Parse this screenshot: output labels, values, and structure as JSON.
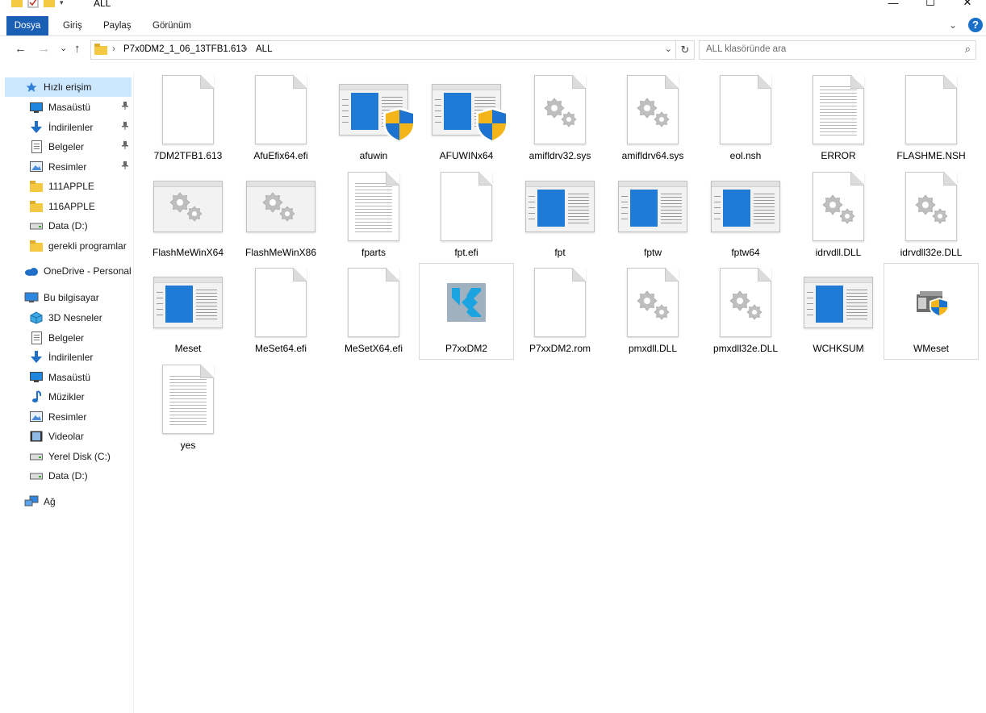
{
  "window": {
    "title": "ALL",
    "minimize_glyph": "—",
    "maximize_glyph": "☐",
    "close_glyph": "✕"
  },
  "ribbon": {
    "tabs": [
      "Dosya",
      "Giriş",
      "Paylaş",
      "Görünüm"
    ],
    "help_label": "?",
    "accent_color": "#1a5fb4"
  },
  "navigation": {
    "back_glyph": "←",
    "forward_glyph": "→",
    "recent_glyph": "⌄",
    "up_glyph": "↑",
    "breadcrumbs": [
      "P7x0DM2_1_06_13TFB1.613",
      "ALL"
    ],
    "separator": "›",
    "refresh_glyph": "↻",
    "search_placeholder": "ALL klasöründe ara"
  },
  "sidebar": {
    "quick_access": "Hızlı erişim",
    "quick_items": [
      {
        "label": "Masaüstü",
        "icon": "desktop-icon",
        "pinned": true
      },
      {
        "label": "İndirilenler",
        "icon": "download-icon",
        "pinned": true
      },
      {
        "label": "Belgeler",
        "icon": "documents-icon",
        "pinned": true
      },
      {
        "label": "Resimler",
        "icon": "pictures-icon",
        "pinned": true
      },
      {
        "label": "111APPLE",
        "icon": "folder-icon",
        "pinned": false
      },
      {
        "label": "116APPLE",
        "icon": "folder-icon",
        "pinned": false
      },
      {
        "label": "Data (D:)",
        "icon": "drive-icon",
        "pinned": false
      },
      {
        "label": "gerekli programlar",
        "icon": "folder-icon",
        "pinned": false
      }
    ],
    "onedrive": "OneDrive - Personal",
    "this_pc": "Bu bilgisayar",
    "pc_items": [
      {
        "label": "3D Nesneler",
        "icon": "3d-objects-icon"
      },
      {
        "label": "Belgeler",
        "icon": "documents-icon"
      },
      {
        "label": "İndirilenler",
        "icon": "download-icon"
      },
      {
        "label": "Masaüstü",
        "icon": "desktop-icon"
      },
      {
        "label": "Müzikler",
        "icon": "music-icon"
      },
      {
        "label": "Resimler",
        "icon": "pictures-icon"
      },
      {
        "label": "Videolar",
        "icon": "video-icon"
      },
      {
        "label": "Yerel Disk (C:)",
        "icon": "drive-icon"
      },
      {
        "label": "Data (D:)",
        "icon": "drive-icon"
      }
    ],
    "network": "Ağ"
  },
  "files": [
    {
      "name": "7DM2TFB1.613",
      "type": "blank"
    },
    {
      "name": "AfuEfix64.efi",
      "type": "blank"
    },
    {
      "name": "afuwin",
      "type": "app-shield"
    },
    {
      "name": "AFUWINx64",
      "type": "app-shield"
    },
    {
      "name": "amifldrv32.sys",
      "type": "gear-doc"
    },
    {
      "name": "amifldrv64.sys",
      "type": "gear-doc"
    },
    {
      "name": "eol.nsh",
      "type": "blank"
    },
    {
      "name": "ERROR",
      "type": "text"
    },
    {
      "name": "FLASHME.NSH",
      "type": "blank"
    },
    {
      "name": "FlashMeWinX64",
      "type": "gear-win"
    },
    {
      "name": "FlashMeWinX86",
      "type": "gear-win"
    },
    {
      "name": "fparts",
      "type": "text"
    },
    {
      "name": "fpt.efi",
      "type": "blank"
    },
    {
      "name": "fpt",
      "type": "app"
    },
    {
      "name": "fptw",
      "type": "app"
    },
    {
      "name": "fptw64",
      "type": "app"
    },
    {
      "name": "idrvdll.DLL",
      "type": "gear-doc"
    },
    {
      "name": "idrvdll32e.DLL",
      "type": "gear-doc"
    },
    {
      "name": "Meset",
      "type": "app"
    },
    {
      "name": "MeSet64.efi",
      "type": "blank"
    },
    {
      "name": "MeSetX64.efi",
      "type": "blank"
    },
    {
      "name": "P7xxDM2",
      "type": "kodi",
      "boxed": true
    },
    {
      "name": "P7xxDM2.rom",
      "type": "blank"
    },
    {
      "name": "pmxdll.DLL",
      "type": "gear-doc"
    },
    {
      "name": "pmxdll32e.DLL",
      "type": "gear-doc"
    },
    {
      "name": "WCHKSUM",
      "type": "app"
    },
    {
      "name": "WMeset",
      "type": "wmeset",
      "boxed": true
    },
    {
      "name": "yes",
      "type": "text"
    }
  ]
}
